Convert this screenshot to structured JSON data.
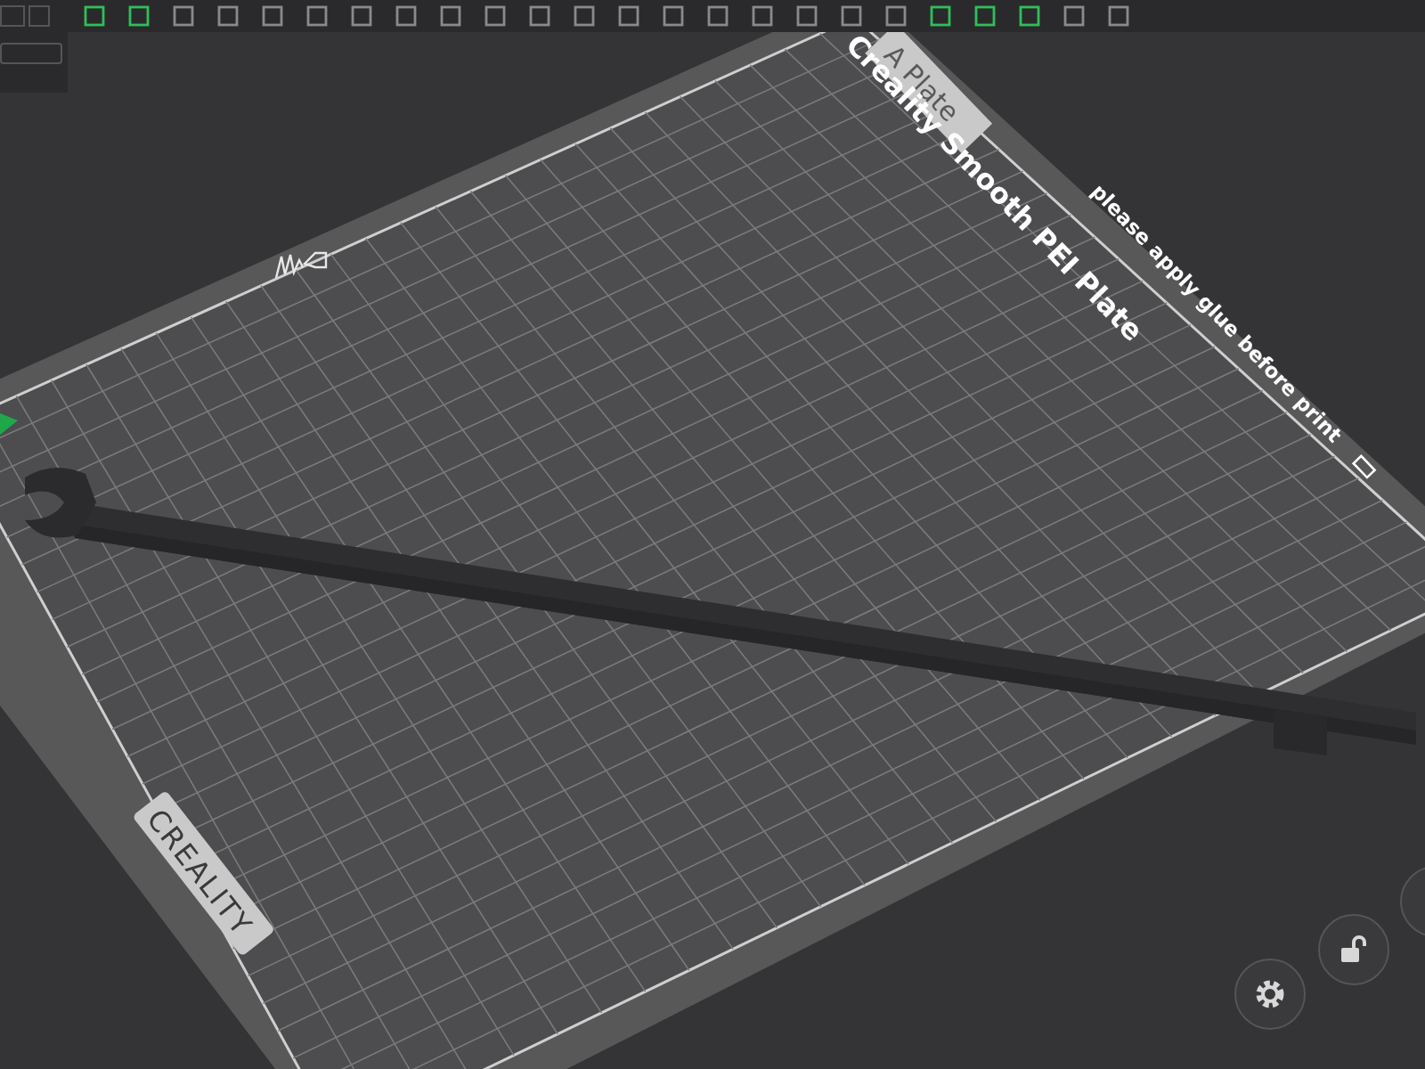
{
  "plate": {
    "tab_label": "A Plate",
    "name": "Creality Smooth PEI Plate",
    "note": "please apply glue before print",
    "brand": "CREALITY"
  }
}
